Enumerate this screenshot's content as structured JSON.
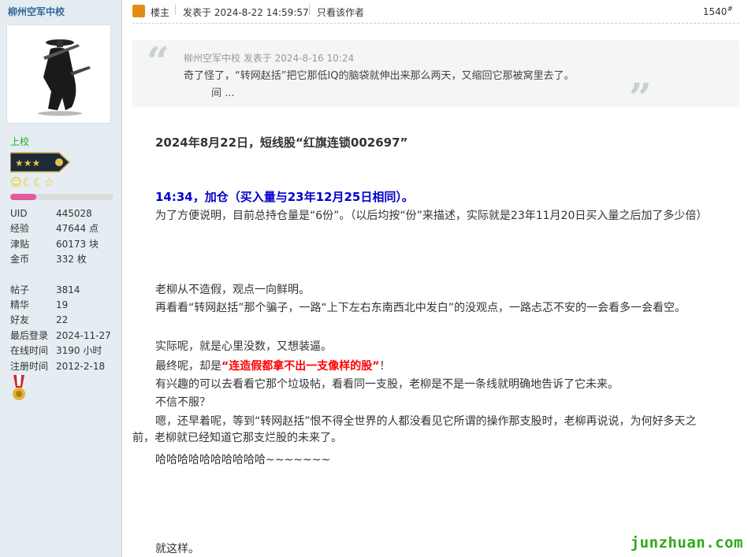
{
  "profile": {
    "username": "柳州空军中校",
    "rank": "上校",
    "credit_fraction": 0.25,
    "stats": [
      {
        "key": "UID",
        "value": "445028"
      },
      {
        "key": "经验",
        "value": "47644 点"
      },
      {
        "key": "津贴",
        "value": "60173 块"
      },
      {
        "key": "金币",
        "value": "332 枚"
      }
    ],
    "stats2": [
      {
        "key": "帖子",
        "value": "3814"
      },
      {
        "key": "精华",
        "value": "19"
      },
      {
        "key": "好友",
        "value": "22"
      },
      {
        "key": "最后登录",
        "value": "2024-11-27"
      },
      {
        "key": "在线时间",
        "value": "3190 小时"
      },
      {
        "key": "注册时间",
        "value": "2012-2-18"
      }
    ]
  },
  "post_header": {
    "op_label": "楼主",
    "posted_at": "发表于 2024-8-22 14:59:57",
    "author_only": "只看该作者",
    "floor": "1540",
    "floor_suffix": "#"
  },
  "quote": {
    "meta": "柳州空军中校 发表于 2024-8-16 10:24",
    "text": "奇了怪了，“转网赵括”把它那低IQ的脑袋就伸出来那么两天，又缩回它那被窝里去了。",
    "more": "间 ..."
  },
  "post": {
    "title": "2024年8月22日，短线股“红旗连锁002697”",
    "add_line": "14:34，加仓（买入量与23年12月25日相同）。",
    "para1": "为了方便说明，目前总持仓量是“6份”。（以后均按“份”来描述，实际就是23年11月20日买入量之后加了多少倍）",
    "p2": "老柳从不造假，观点一向鲜明。",
    "p3": "再看看“转网赵括”那个骗子，一路“上下左右东南西北中发白”的没观点，一路忐忑不安的一会看多一会看空。",
    "p4": "实际呢，就是心里没数，又想装逼。",
    "p5_a": "最终呢，却是",
    "p5_red": "“连造假都拿不出一支像样的股”",
    "p5_b": "！",
    "p6": "有兴趣的可以去看看它那个垃圾帖，看看同一支股，老柳是不是一条线就明确地告诉了它未来。",
    "p7": "不信不服？",
    "p8": "嗯，还早着呢，等到“转网赵括”恨不得全世界的人都没看见它所谓的操作那支股时，老柳再说说，为何好多天之前，老柳就已经知道它那支烂股的未来了。",
    "p9": "哈哈哈哈哈哈哈哈哈哈~~~~~~~",
    "p10": "就这样。"
  },
  "watermark": "junzhuan.com",
  "colors": {
    "accent": "#336699",
    "blue_text": "#0000cc",
    "red_text": "#ff0000",
    "watermark": "#2ea81a"
  }
}
